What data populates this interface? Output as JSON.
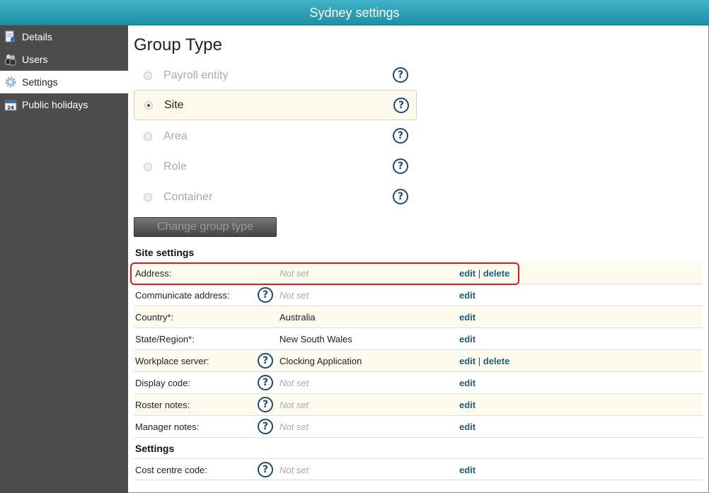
{
  "window": {
    "title": "Sydney settings"
  },
  "sidebar": {
    "items": [
      {
        "label": "Details",
        "icon": "details-doc-icon",
        "active": false
      },
      {
        "label": "Users",
        "icon": "users-icon",
        "active": false
      },
      {
        "label": "Settings",
        "icon": "gear-icon",
        "active": true
      },
      {
        "label": "Public holidays",
        "icon": "calendar-icon",
        "active": false,
        "calendar_day": "24"
      }
    ]
  },
  "group_type": {
    "title": "Group Type",
    "options": [
      {
        "label": "Payroll entity",
        "selected": false
      },
      {
        "label": "Site",
        "selected": true
      },
      {
        "label": "Area",
        "selected": false
      },
      {
        "label": "Role",
        "selected": false
      },
      {
        "label": "Container",
        "selected": false
      }
    ],
    "help_glyph": "?",
    "change_button": "Change group type"
  },
  "site_settings": {
    "heading": "Site settings",
    "rows": [
      {
        "label": "Address:",
        "value": "Not set",
        "has_help": false,
        "edit": "edit",
        "delete": "delete"
      },
      {
        "label": "Communicate address:",
        "value": "Not set",
        "has_help": true,
        "edit": "edit",
        "delete": null
      },
      {
        "label": "Country*:",
        "value": "Australia",
        "has_help": false,
        "edit": "edit",
        "delete": null
      },
      {
        "label": "State/Region*:",
        "value": "New South Wales",
        "has_help": false,
        "edit": "edit",
        "delete": null
      },
      {
        "label": "Workplace server:",
        "value": "Clocking Application",
        "has_help": true,
        "edit": "edit",
        "delete": "delete"
      },
      {
        "label": "Display code:",
        "value": "Not set",
        "has_help": true,
        "edit": "edit",
        "delete": null
      },
      {
        "label": "Roster notes:",
        "value": "Not set",
        "has_help": true,
        "edit": "edit",
        "delete": null
      },
      {
        "label": "Manager notes:",
        "value": "Not set",
        "has_help": true,
        "edit": "edit",
        "delete": null
      }
    ]
  },
  "settings": {
    "heading": "Settings",
    "rows": [
      {
        "label": "Cost centre code:",
        "value": "Not set",
        "has_help": true,
        "edit": "edit",
        "delete": null
      }
    ]
  },
  "separator": "|",
  "colors": {
    "accent": "#1f8fa6",
    "link": "#1d5f7a",
    "highlight": "#e01a1a",
    "sidebar": "#4c4c4c"
  }
}
